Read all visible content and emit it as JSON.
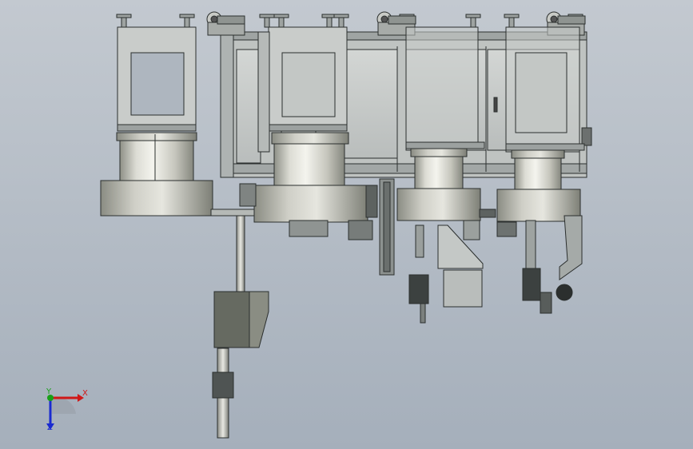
{
  "viewport": {
    "background_top": "#c3c9d0",
    "background_bottom": "#a5afbb"
  },
  "model": {
    "view": "front",
    "component_names": [
      "support-frame",
      "leveling-foot",
      "cylindrical-drum",
      "turntable-ring",
      "electrical-cabinet",
      "gearbox-block",
      "vertical-shaft",
      "actuator-assembly",
      "control-box",
      "bent-bracket"
    ]
  },
  "triad": {
    "x_label": "X",
    "y_label": "Y",
    "z_label": "Z",
    "x_color": "#d01818",
    "y_color": "#18a018",
    "z_color": "#1a2ad0"
  }
}
